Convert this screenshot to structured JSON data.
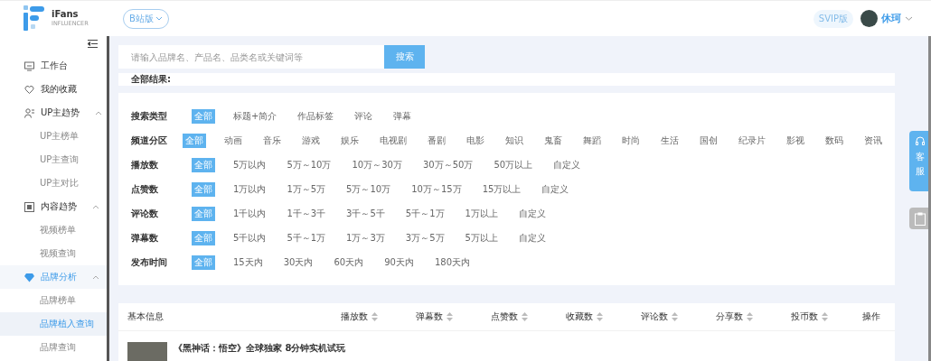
{
  "header": {
    "logo_name": "iFans",
    "logo_sub": "INFLUENCER",
    "version_button": "B站版",
    "vip_badge": "SVIP版",
    "user_name": "休珂"
  },
  "sidebar": {
    "items": [
      {
        "kind": "page",
        "label": "工作台",
        "selected": false
      },
      {
        "kind": "page",
        "label": "我的收藏",
        "selected": false
      },
      {
        "kind": "group",
        "label": "UP主趋势",
        "selected": false,
        "expanded": true,
        "children": [
          {
            "label": "UP主榜单",
            "selected": false
          },
          {
            "label": "UP主查询",
            "selected": false
          },
          {
            "label": "UP主对比",
            "selected": false
          }
        ]
      },
      {
        "kind": "group",
        "label": "内容趋势",
        "selected": false,
        "expanded": true,
        "children": [
          {
            "label": "视频榜单",
            "selected": false
          },
          {
            "label": "视频查询",
            "selected": false
          }
        ]
      },
      {
        "kind": "group",
        "label": "品牌分析",
        "selected": true,
        "expanded": true,
        "children": [
          {
            "label": "品牌榜单",
            "selected": false
          },
          {
            "label": "品牌植入查询",
            "selected": true
          },
          {
            "label": "品牌查询",
            "selected": false
          }
        ]
      }
    ]
  },
  "search": {
    "placeholder": "请输入品牌名、产品名、品类名或关键词等",
    "button": "搜索"
  },
  "results_label": "全部结果:",
  "filters": [
    {
      "label": "搜索类型",
      "options": [
        {
          "label": "全部",
          "selected": true
        },
        {
          "label": "标题+简介",
          "selected": false
        },
        {
          "label": "作品标签",
          "selected": false
        },
        {
          "label": "评论",
          "selected": false
        },
        {
          "label": "弹幕",
          "selected": false
        }
      ]
    },
    {
      "label": "频道分区",
      "options": [
        {
          "label": "全部",
          "selected": true
        },
        {
          "label": "动画",
          "selected": false
        },
        {
          "label": "音乐",
          "selected": false
        },
        {
          "label": "游戏",
          "selected": false
        },
        {
          "label": "娱乐",
          "selected": false
        },
        {
          "label": "电视剧",
          "selected": false
        },
        {
          "label": "番剧",
          "selected": false
        },
        {
          "label": "电影",
          "selected": false
        },
        {
          "label": "知识",
          "selected": false
        },
        {
          "label": "鬼畜",
          "selected": false
        },
        {
          "label": "舞蹈",
          "selected": false
        },
        {
          "label": "时尚",
          "selected": false
        },
        {
          "label": "生活",
          "selected": false
        },
        {
          "label": "国创",
          "selected": false
        },
        {
          "label": "纪录片",
          "selected": false
        },
        {
          "label": "影视",
          "selected": false
        },
        {
          "label": "数码",
          "selected": false
        },
        {
          "label": "资讯",
          "selected": false
        }
      ]
    },
    {
      "label": "播放数",
      "options": [
        {
          "label": "全部",
          "selected": true
        },
        {
          "label": "5万以内",
          "selected": false
        },
        {
          "label": "5万～10万",
          "selected": false
        },
        {
          "label": "10万～30万",
          "selected": false
        },
        {
          "label": "30万～50万",
          "selected": false
        },
        {
          "label": "50万以上",
          "selected": false
        },
        {
          "label": "自定义",
          "selected": false
        }
      ]
    },
    {
      "label": "点赞数",
      "options": [
        {
          "label": "全部",
          "selected": true
        },
        {
          "label": "1万以内",
          "selected": false
        },
        {
          "label": "1万～5万",
          "selected": false
        },
        {
          "label": "5万～10万",
          "selected": false
        },
        {
          "label": "10万～15万",
          "selected": false
        },
        {
          "label": "15万以上",
          "selected": false
        },
        {
          "label": "自定义",
          "selected": false
        }
      ]
    },
    {
      "label": "评论数",
      "options": [
        {
          "label": "全部",
          "selected": true
        },
        {
          "label": "1千以内",
          "selected": false
        },
        {
          "label": "1千～3千",
          "selected": false
        },
        {
          "label": "3千～5千",
          "selected": false
        },
        {
          "label": "5千～1万",
          "selected": false
        },
        {
          "label": "1万以上",
          "selected": false
        },
        {
          "label": "自定义",
          "selected": false
        }
      ]
    },
    {
      "label": "弹幕数",
      "options": [
        {
          "label": "全部",
          "selected": true
        },
        {
          "label": "5千以内",
          "selected": false
        },
        {
          "label": "5千～1万",
          "selected": false
        },
        {
          "label": "1万～3万",
          "selected": false
        },
        {
          "label": "3万～5万",
          "selected": false
        },
        {
          "label": "5万以上",
          "selected": false
        },
        {
          "label": "自定义",
          "selected": false
        }
      ]
    },
    {
      "label": "发布时间",
      "options": [
        {
          "label": "全部",
          "selected": true
        },
        {
          "label": "15天内",
          "selected": false
        },
        {
          "label": "30天内",
          "selected": false
        },
        {
          "label": "60天内",
          "selected": false
        },
        {
          "label": "90天内",
          "selected": false
        },
        {
          "label": "180天内",
          "selected": false
        }
      ]
    }
  ],
  "table": {
    "columns": [
      {
        "label": "基本信息",
        "sortable": false
      },
      {
        "label": "播放数",
        "sortable": true
      },
      {
        "label": "弹幕数",
        "sortable": true
      },
      {
        "label": "点赞数",
        "sortable": true
      },
      {
        "label": "收藏数",
        "sortable": true
      },
      {
        "label": "评论数",
        "sortable": true
      },
      {
        "label": "分享数",
        "sortable": true
      },
      {
        "label": "投币数",
        "sortable": true
      },
      {
        "label": "操作",
        "sortable": false
      }
    ],
    "rows": [
      {
        "title": "《黑神话：悟空》全球独家 8分钟实机试玩"
      }
    ]
  },
  "side_widget": {
    "service": "客服"
  }
}
